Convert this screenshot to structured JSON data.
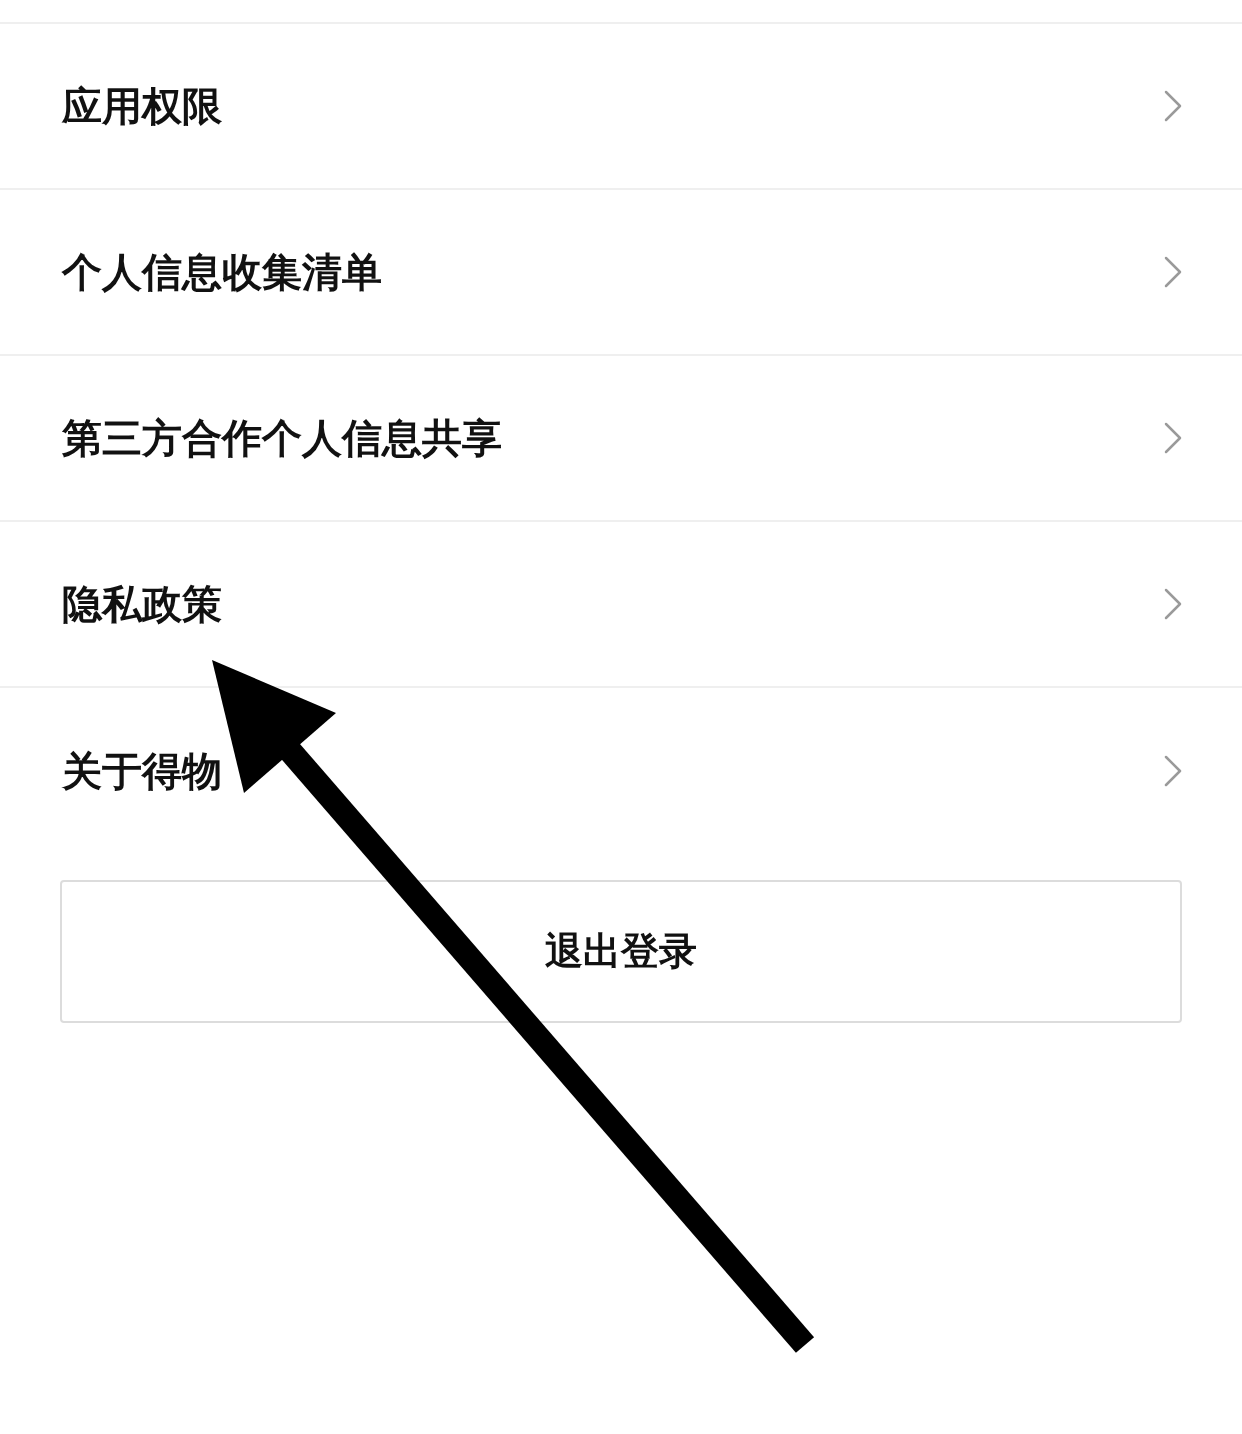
{
  "menu_items": [
    {
      "label": "应用权限"
    },
    {
      "label": "个人信息收集清单"
    },
    {
      "label": "第三方合作个人信息共享"
    },
    {
      "label": "隐私政策"
    },
    {
      "label": "关于得物"
    }
  ],
  "logout_button": {
    "label": "退出登录"
  }
}
